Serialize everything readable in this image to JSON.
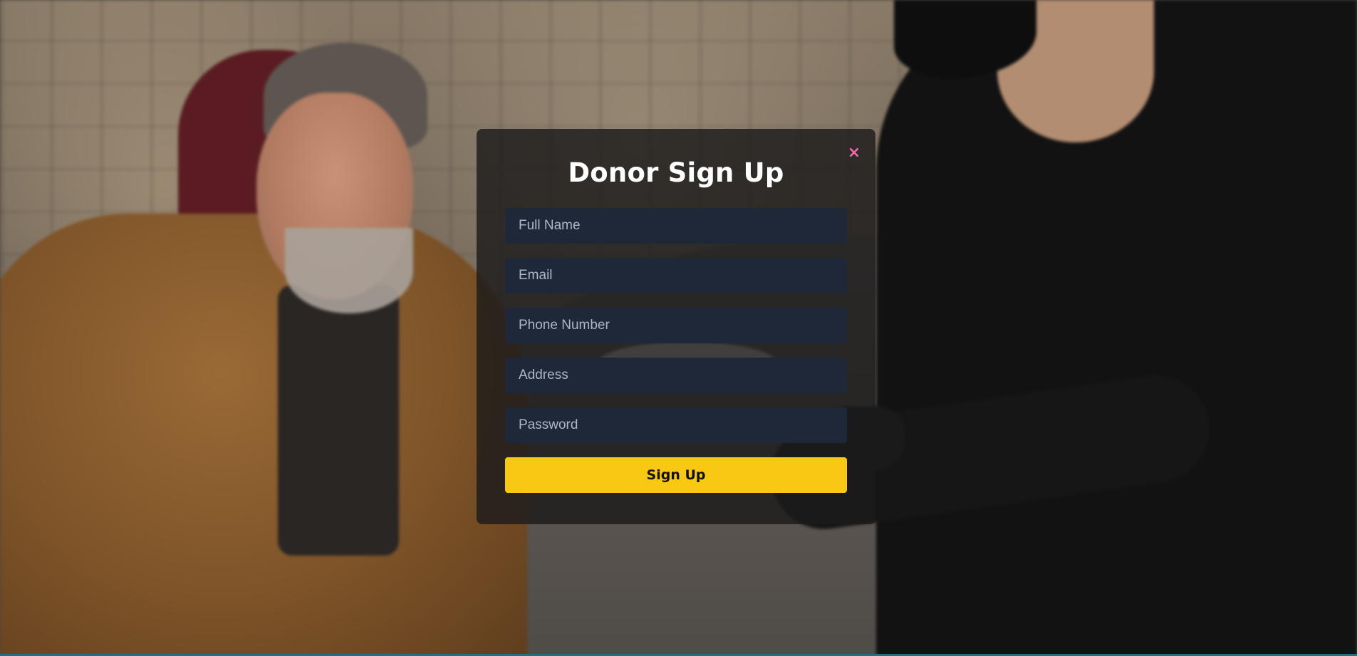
{
  "modal": {
    "title": "Donor Sign Up",
    "close_icon": "close-icon",
    "close_symbol": "×"
  },
  "form": {
    "fields": [
      {
        "name": "full_name",
        "placeholder": "Full Name",
        "value": ""
      },
      {
        "name": "email",
        "placeholder": "Email",
        "value": ""
      },
      {
        "name": "phone",
        "placeholder": "Phone Number",
        "value": ""
      },
      {
        "name": "address",
        "placeholder": "Address",
        "value": ""
      },
      {
        "name": "password",
        "placeholder": "Password",
        "value": ""
      }
    ],
    "submit_label": "Sign Up"
  },
  "colors": {
    "accent": "#f8c814",
    "close": "#f06aa5",
    "field_bg": "#1f2839",
    "modal_bg": "rgba(28,27,27,0.82)"
  }
}
